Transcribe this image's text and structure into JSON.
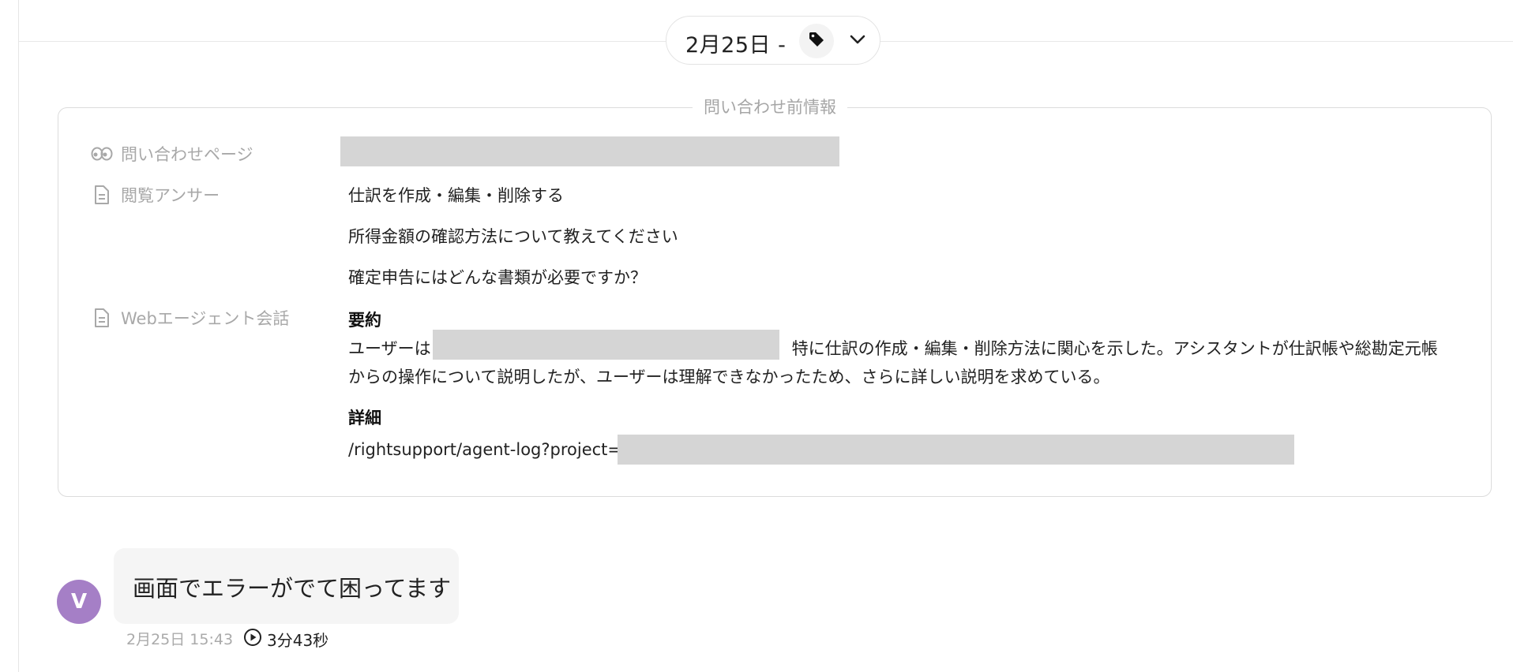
{
  "header": {
    "date_label": "2月25日 -",
    "tag_icon": "tag-icon",
    "dropdown_icon": "chevron-down-icon"
  },
  "pre_info": {
    "legend": "問い合わせ前情報",
    "inquiry_page": {
      "label": "問い合わせページ",
      "icon": "eyes-icon"
    },
    "viewed_answers": {
      "label": "閲覧アンサー",
      "icon": "document-icon",
      "items": [
        "仕訳を作成・編集・削除する",
        "所得金額の確認方法について教えてください",
        "確定申告にはどんな書類が必要ですか？"
      ]
    },
    "web_agent": {
      "label": "Webエージェント会話",
      "icon": "document-icon",
      "summary_heading": "要約",
      "summary_prefix": "ユーザーは",
      "summary_body": "特に仕訳の作成・編集・削除方法に関心を示した。アシスタントが仕訳帳や総勘定元帳からの操作について説明したが、ユーザーは理解できなかったため、さらに詳しい説明を求めている。",
      "details_heading": "詳細",
      "details_link_prefix": "/rightsupport/agent-log?project="
    }
  },
  "message": {
    "avatar_initial": "V",
    "text": "画面でエラーがでて困ってます",
    "timestamp": "2月25日 15:43",
    "duration": "3分43秒",
    "duration_icon": "play-circle-icon"
  },
  "colors": {
    "avatar": "#a57fc6",
    "redaction": "#d5d5d5",
    "bubble": "#f5f5f5",
    "label_gray": "#a8a8a8"
  }
}
